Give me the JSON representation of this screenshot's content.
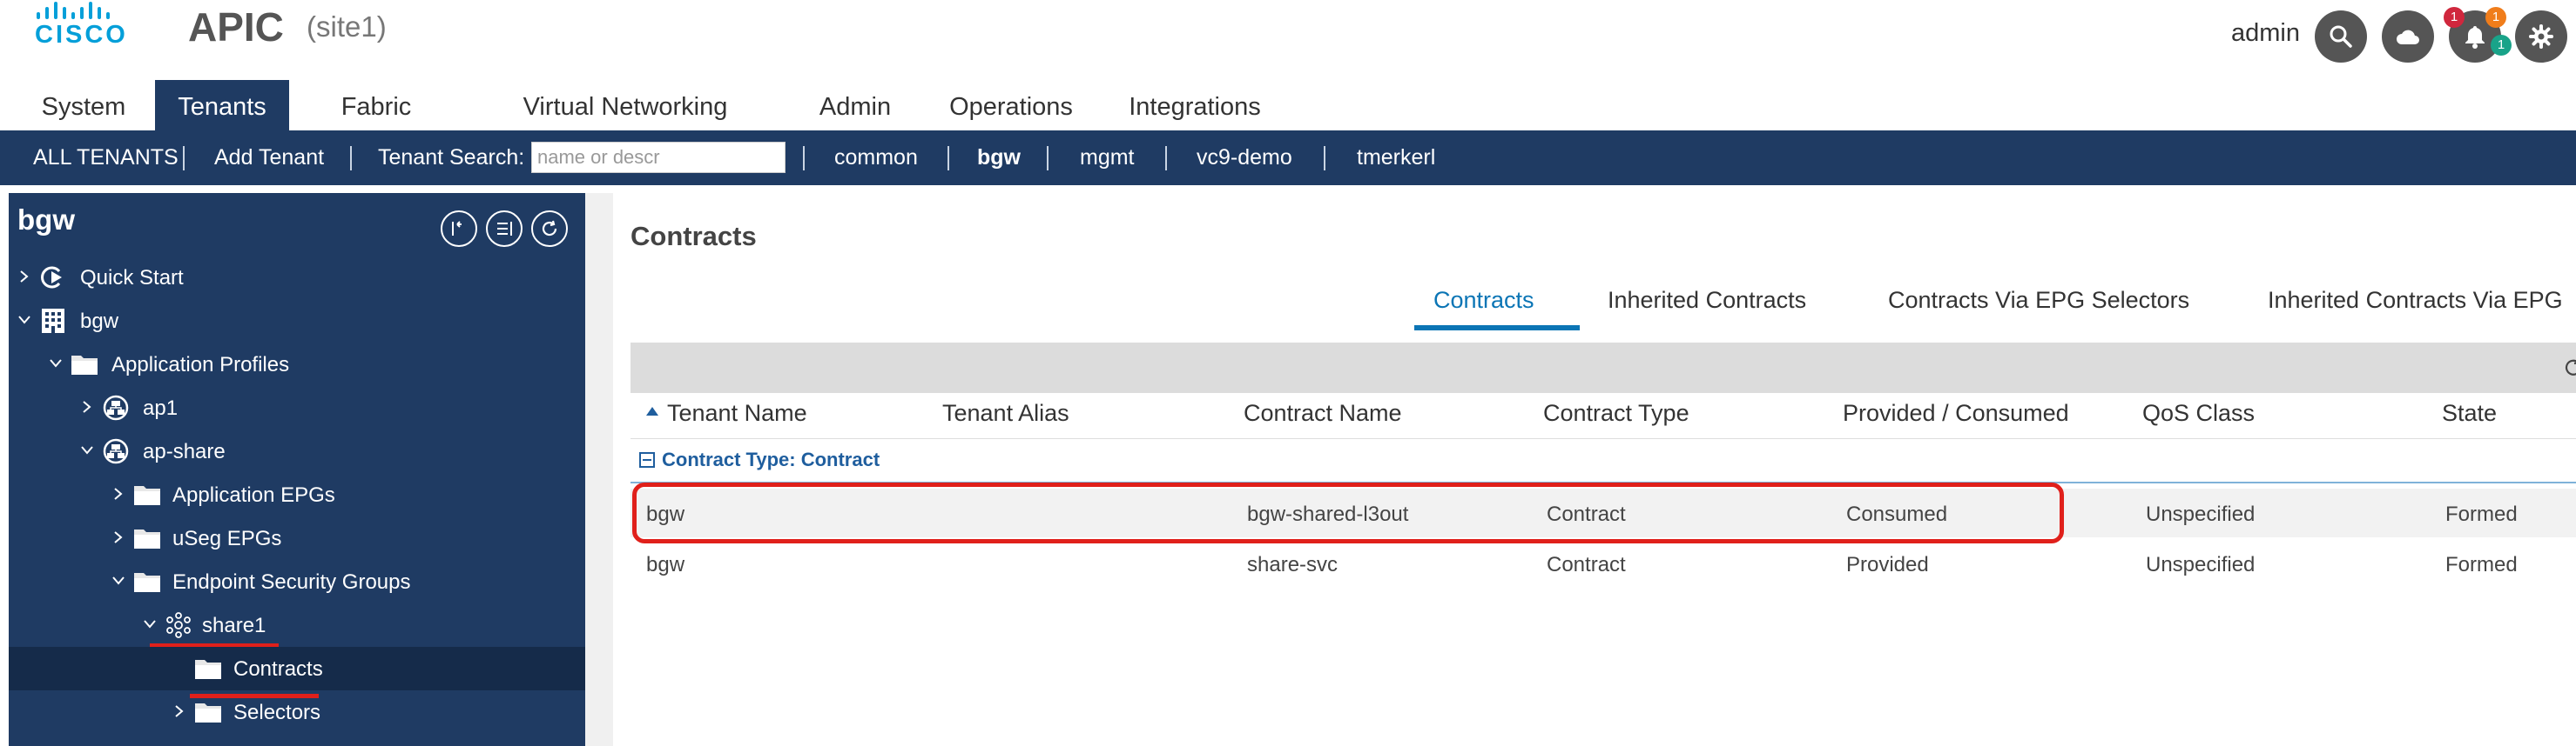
{
  "header": {
    "logo_text": "CISCO",
    "app_title": "APIC",
    "site": "(site1)",
    "user": "admin",
    "icons": [
      "search-icon",
      "cloud-icon",
      "bell-icon",
      "gear-icon"
    ],
    "notification_counts": [
      "1",
      "1",
      "1"
    ],
    "colors": {
      "brand": "#049fd9",
      "nav_bg": "#1f3b63",
      "badge_red": "#d0273d",
      "badge_orange": "#f07d1b",
      "badge_green": "#19a389"
    }
  },
  "topnav": {
    "tabs": [
      "System",
      "Tenants",
      "Fabric",
      "Virtual Networking",
      "Admin",
      "Operations",
      "Integrations"
    ],
    "active": "Tenants"
  },
  "subbar": {
    "all_tenants": "ALL TENANTS",
    "add_tenant": "Add Tenant",
    "search_label": "Tenant Search:",
    "search_placeholder": "name or descr",
    "tenants": [
      "common",
      "bgw",
      "mgmt",
      "vc9-demo",
      "tmerkerl"
    ],
    "active_tenant": "bgw"
  },
  "sidebar": {
    "title": "bgw",
    "tree": [
      {
        "label": "Quick Start",
        "icon": "quick-start-icon"
      },
      {
        "label": "bgw",
        "icon": "building-icon"
      },
      {
        "label": "Application Profiles",
        "icon": "folder-icon"
      },
      {
        "label": "ap1",
        "icon": "app-profile-icon"
      },
      {
        "label": "ap-share",
        "icon": "app-profile-icon"
      },
      {
        "label": "Application EPGs",
        "icon": "folder-icon"
      },
      {
        "label": "uSeg EPGs",
        "icon": "folder-icon"
      },
      {
        "label": "Endpoint Security Groups",
        "icon": "folder-icon"
      },
      {
        "label": "share1",
        "icon": "esg-icon"
      },
      {
        "label": "Contracts",
        "icon": "folder-icon",
        "selected": true
      },
      {
        "label": "Selectors",
        "icon": "folder-icon"
      }
    ]
  },
  "main": {
    "title": "Contracts",
    "tabs": [
      "Contracts",
      "Inherited Contracts",
      "Contracts Via EPG Selectors",
      "Inherited Contracts Via EPG"
    ],
    "active_tab": "Contracts",
    "columns": [
      "Tenant Name",
      "Tenant Alias",
      "Contract Name",
      "Contract Type",
      "Provided / Consumed",
      "QoS Class",
      "State"
    ],
    "group_label": "Contract Type: Contract",
    "rows": [
      [
        "bgw",
        "",
        "bgw-shared-l3out",
        "Contract",
        "Consumed",
        "Unspecified",
        "Formed"
      ],
      [
        "bgw",
        "",
        "share-svc",
        "Contract",
        "Provided",
        "Unspecified",
        "Formed"
      ]
    ]
  }
}
